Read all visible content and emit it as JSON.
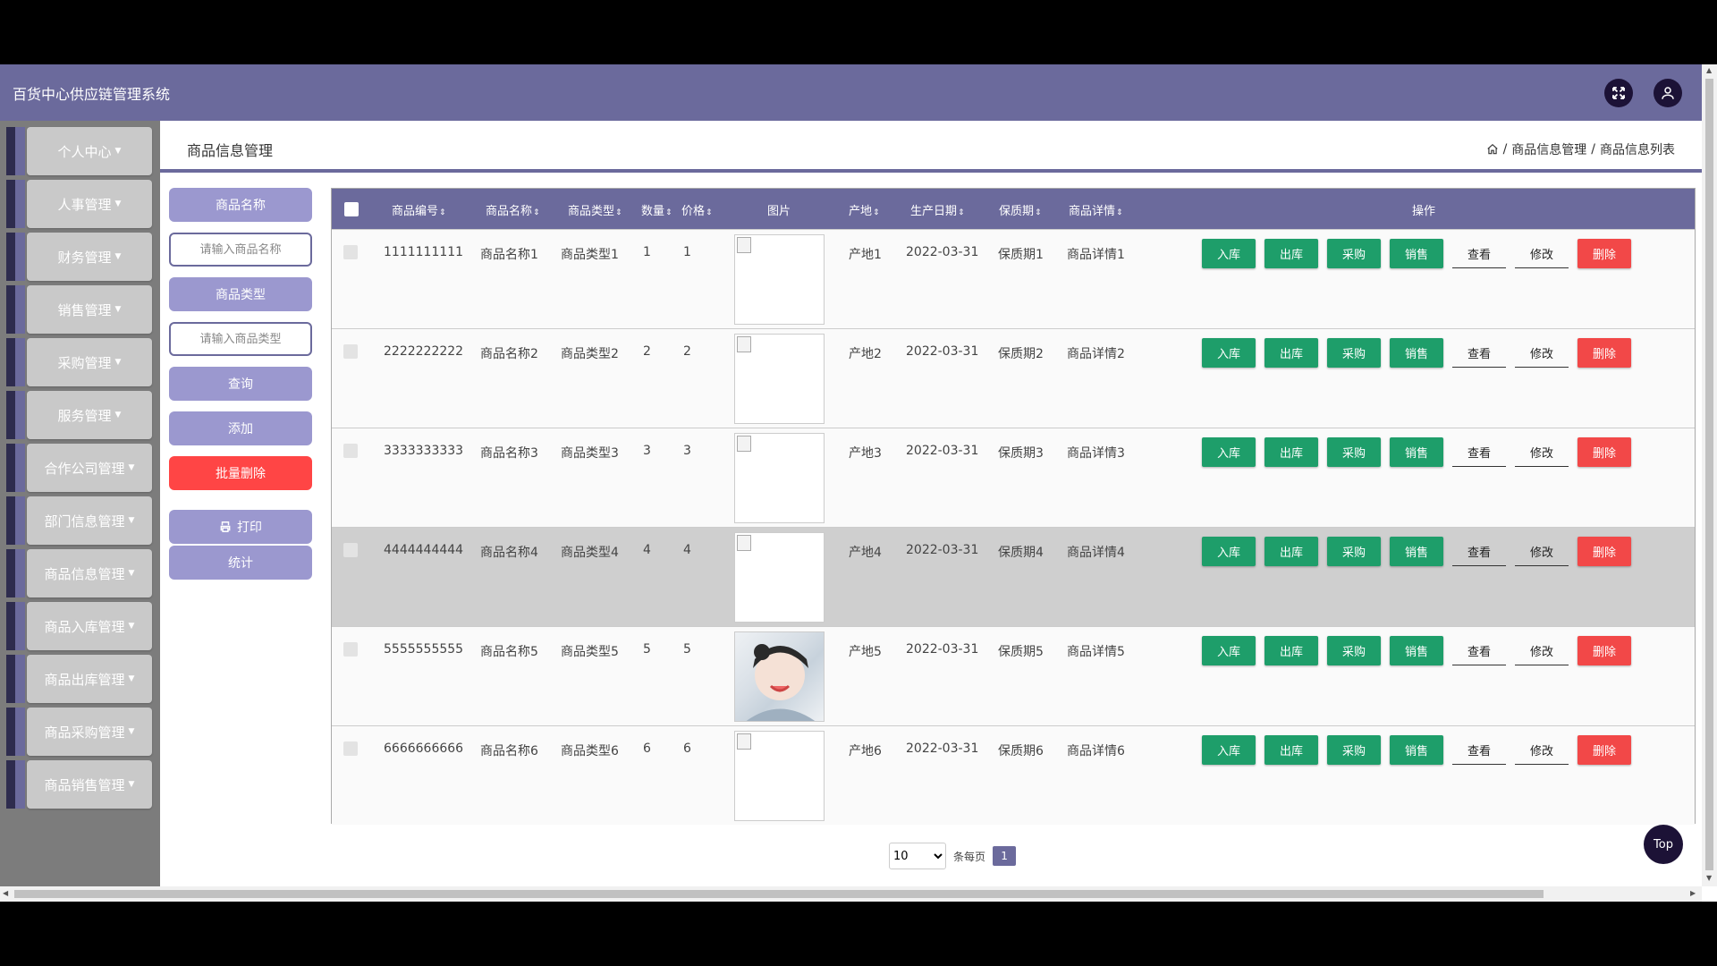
{
  "app": {
    "title": "百货中心供应链管理系统"
  },
  "header": {
    "fullscreen_icon": "fullscreen-icon",
    "user_icon": "user-icon"
  },
  "sidebar": {
    "items": [
      {
        "label": "个人中心"
      },
      {
        "label": "人事管理"
      },
      {
        "label": "财务管理"
      },
      {
        "label": "销售管理"
      },
      {
        "label": "采购管理"
      },
      {
        "label": "服务管理"
      },
      {
        "label": "合作公司管理"
      },
      {
        "label": "部门信息管理"
      },
      {
        "label": "商品信息管理"
      },
      {
        "label": "商品入库管理"
      },
      {
        "label": "商品出库管理"
      },
      {
        "label": "商品采购管理"
      },
      {
        "label": "商品销售管理"
      }
    ]
  },
  "breadcrumb": {
    "title": "商品信息管理",
    "path_1": "商品信息管理",
    "path_2": "商品信息列表",
    "sep": "/"
  },
  "search": {
    "name_label": "商品名称",
    "name_placeholder": "请输入商品名称",
    "type_label": "商品类型",
    "type_placeholder": "请输入商品类型",
    "query_button": "查询",
    "add_button": "添加",
    "batch_delete_button": "批量删除",
    "print_button": "打印",
    "stats_button": "统计"
  },
  "table": {
    "columns": {
      "code": "商品编号",
      "name": "商品名称",
      "type": "商品类型",
      "qty": "数量",
      "price": "价格",
      "image": "图片",
      "origin": "产地",
      "date": "生产日期",
      "shelf": "保质期",
      "detail": "商品详情",
      "ops": "操作"
    },
    "actions": {
      "in": "入库",
      "out": "出库",
      "purchase": "采购",
      "sell": "销售",
      "view": "查看",
      "edit": "修改",
      "delete": "删除"
    },
    "rows": [
      {
        "code": "1111111111",
        "name": "商品名称1",
        "type": "商品类型1",
        "qty": "1",
        "price": "1",
        "origin": "产地1",
        "date": "2022-03-31",
        "shelf": "保质期1",
        "detail": "商品详情1"
      },
      {
        "code": "2222222222",
        "name": "商品名称2",
        "type": "商品类型2",
        "qty": "2",
        "price": "2",
        "origin": "产地2",
        "date": "2022-03-31",
        "shelf": "保质期2",
        "detail": "商品详情2"
      },
      {
        "code": "3333333333",
        "name": "商品名称3",
        "type": "商品类型3",
        "qty": "3",
        "price": "3",
        "origin": "产地3",
        "date": "2022-03-31",
        "shelf": "保质期3",
        "detail": "商品详情3"
      },
      {
        "code": "4444444444",
        "name": "商品名称4",
        "type": "商品类型4",
        "qty": "4",
        "price": "4",
        "origin": "产地4",
        "date": "2022-03-31",
        "shelf": "保质期4",
        "detail": "商品详情4"
      },
      {
        "code": "5555555555",
        "name": "商品名称5",
        "type": "商品类型5",
        "qty": "5",
        "price": "5",
        "origin": "产地5",
        "date": "2022-03-31",
        "shelf": "保质期5",
        "detail": "商品详情5"
      },
      {
        "code": "6666666666",
        "name": "商品名称6",
        "type": "商品类型6",
        "qty": "6",
        "price": "6",
        "origin": "产地6",
        "date": "2022-03-31",
        "shelf": "保质期6",
        "detail": "商品详情6"
      }
    ]
  },
  "pager": {
    "page_size": "10",
    "per_page_label": "条每页",
    "current_page": "1"
  },
  "top_button": "Top",
  "colors": {
    "primary": "#6b6a9c",
    "accent_light": "#9b98cf",
    "green": "#1e9e6a",
    "danger": "#f24848",
    "dark": "#1c1236"
  }
}
